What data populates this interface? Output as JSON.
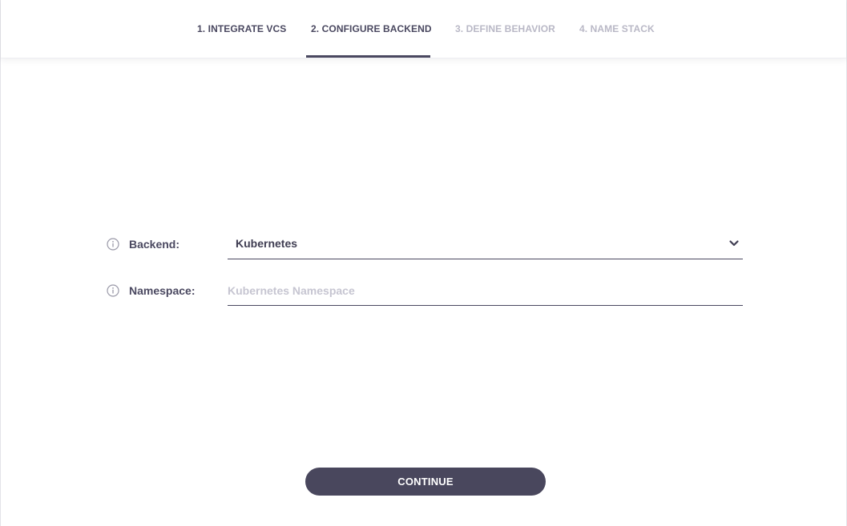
{
  "steps": [
    {
      "label": "1. INTEGRATE VCS",
      "state": "done"
    },
    {
      "label": "2. CONFIGURE BACKEND",
      "state": "active"
    },
    {
      "label": "3. DEFINE BEHAVIOR",
      "state": "pending"
    },
    {
      "label": "4. NAME STACK",
      "state": "pending"
    }
  ],
  "form": {
    "backend": {
      "label": "Backend:",
      "value": "Kubernetes",
      "icon": "info-icon",
      "dropdown_icon": "chevron-down-icon"
    },
    "namespace": {
      "label": "Namespace:",
      "value": "",
      "placeholder": "Kubernetes Namespace",
      "icon": "info-icon"
    }
  },
  "actions": {
    "continue_label": "CONTINUE"
  },
  "colors": {
    "primary": "#49475d",
    "text": "#4a4860",
    "muted": "#b9b8c6",
    "placeholder": "#c6c5d1"
  }
}
